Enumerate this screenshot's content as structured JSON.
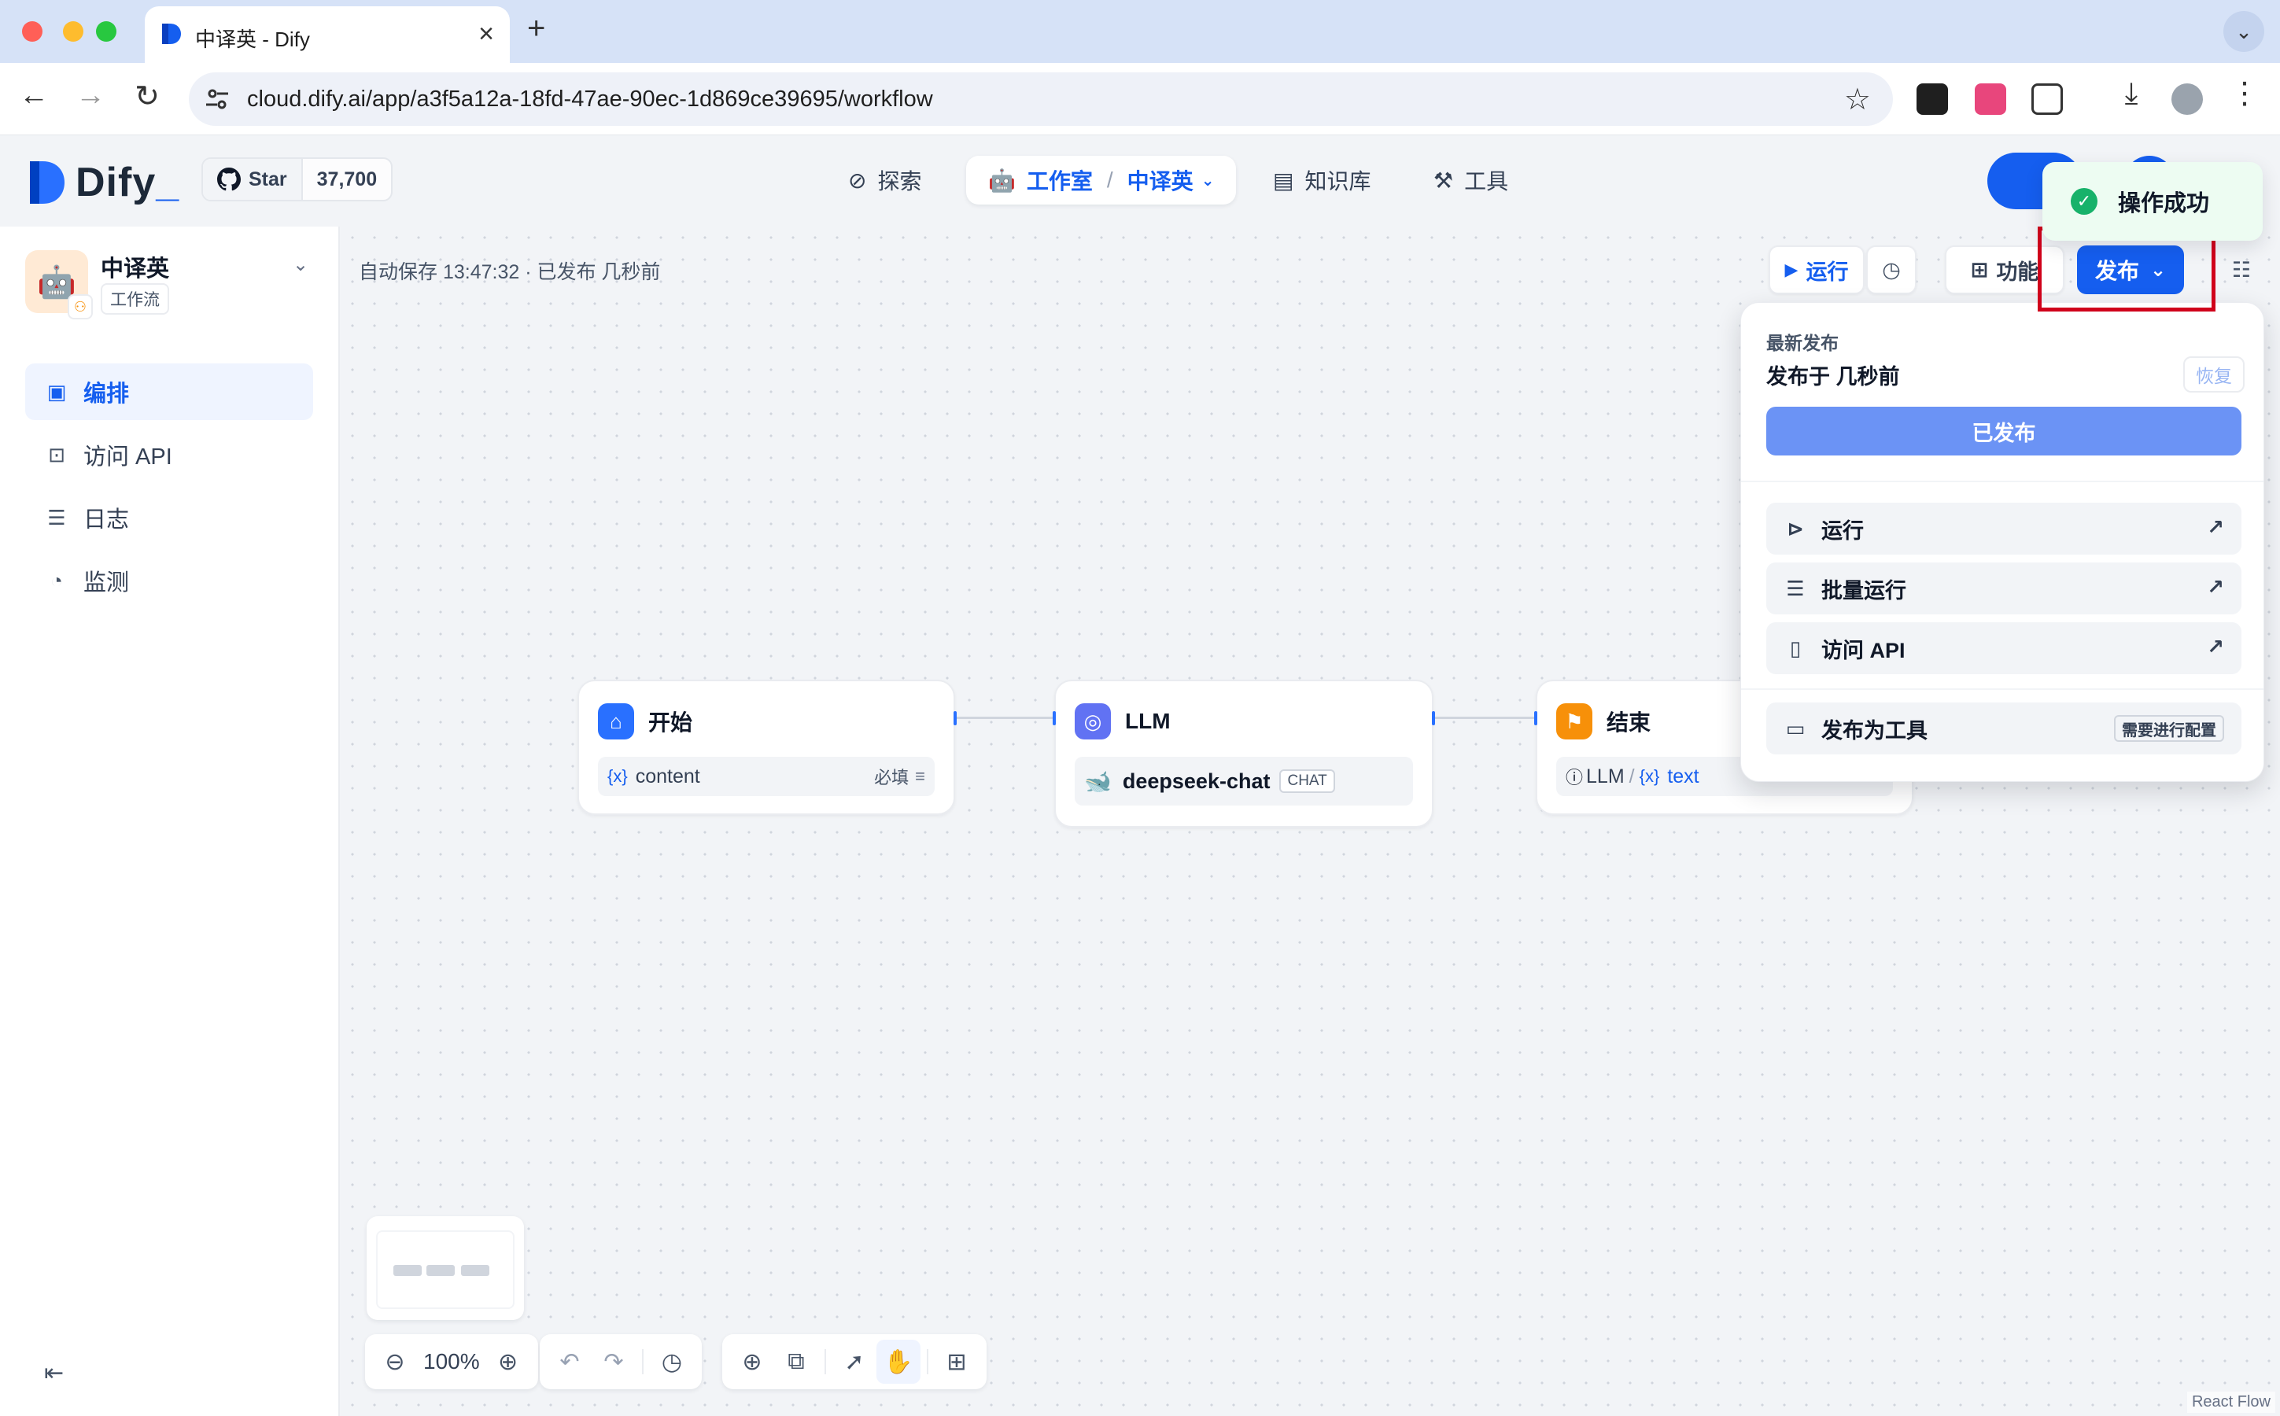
{
  "browser": {
    "tab_title": "中译英 - Dify",
    "url": "cloud.dify.ai/app/a3f5a12a-18fd-47ae-90ec-1d869ce39695/workflow"
  },
  "header": {
    "logo": "Dify",
    "github_star_label": "Star",
    "github_star_count": "37,700",
    "nav": {
      "explore": "探索",
      "studio": "工作室",
      "current_app": "中译英",
      "knowledge": "知识库",
      "tools": "工具"
    }
  },
  "toast": {
    "message": "操作成功"
  },
  "sidebar": {
    "app_name": "中译英",
    "app_type": "工作流",
    "items": [
      {
        "label": "编排",
        "icon": "layout-icon",
        "active": true
      },
      {
        "label": "访问 API",
        "icon": "terminal-icon",
        "active": false
      },
      {
        "label": "日志",
        "icon": "file-list-icon",
        "active": false
      },
      {
        "label": "监测",
        "icon": "gauge-icon",
        "active": false
      }
    ]
  },
  "canvas": {
    "autosave": "自动保存 13:47:32 · 已发布 几秒前",
    "run_label": "运行",
    "features_label": "功能",
    "publish_label": "发布",
    "nodes": {
      "start": {
        "title": "开始",
        "var": "content",
        "required": "必填"
      },
      "llm": {
        "title": "LLM",
        "model": "deepseek-chat",
        "mode": "CHAT"
      },
      "end": {
        "title": "结束",
        "source_node": "LLM",
        "var": "text"
      }
    },
    "zoom": "100%",
    "watermark": "React Flow"
  },
  "publish_panel": {
    "latest_label": "最新发布",
    "published_time": "发布于 几秒前",
    "restore_label": "恢复",
    "published_button": "已发布",
    "items": [
      {
        "label": "运行",
        "icon": "play-circle-icon"
      },
      {
        "label": "批量运行",
        "icon": "list-indent-icon"
      },
      {
        "label": "访问 API",
        "icon": "file-text-icon"
      }
    ],
    "tool_item": {
      "label": "发布为工具",
      "tag": "需要进行配置"
    }
  },
  "colors": {
    "primary": "#155eef",
    "toast_bg": "#edfcf2",
    "success": "#17b26a",
    "highlight": "#d0021b"
  }
}
